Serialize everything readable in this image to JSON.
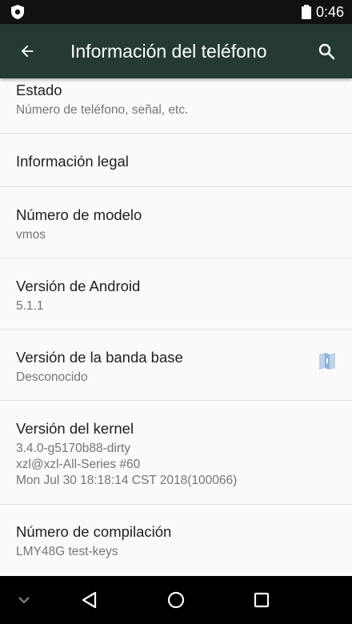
{
  "status_bar": {
    "time": "0:46",
    "left_icon": "vpn-shield-icon",
    "battery_icon": "battery-icon"
  },
  "toolbar": {
    "title": "Información del teléfono",
    "back_icon": "arrow-back-icon",
    "search_icon": "search-icon",
    "background_color": "#243a32"
  },
  "items": [
    {
      "title": "Estado",
      "subtitle": "Número de teléfono, señal, etc."
    },
    {
      "title": "Información legal"
    },
    {
      "title": "Número de modelo",
      "subtitle": "vmos"
    },
    {
      "title": "Versión de Android",
      "subtitle": "5.1.1"
    },
    {
      "title": "Versión de la banda base",
      "subtitle": "Desconocido",
      "icon": "document-icon"
    },
    {
      "title": "Versión del kernel",
      "subtitle_lines": [
        "3.4.0-g5170b88-dirty",
        "xzl@xzl-All-Series #60",
        "Mon Jul 30 18:18:14 CST 2018(100066)"
      ]
    },
    {
      "title": "Número de compilación",
      "subtitle": "LMY48G test-keys"
    }
  ],
  "nav_bar": {
    "buttons": [
      "chevron-down-icon",
      "back-triangle-icon",
      "home-circle-icon",
      "recents-square-icon"
    ]
  }
}
